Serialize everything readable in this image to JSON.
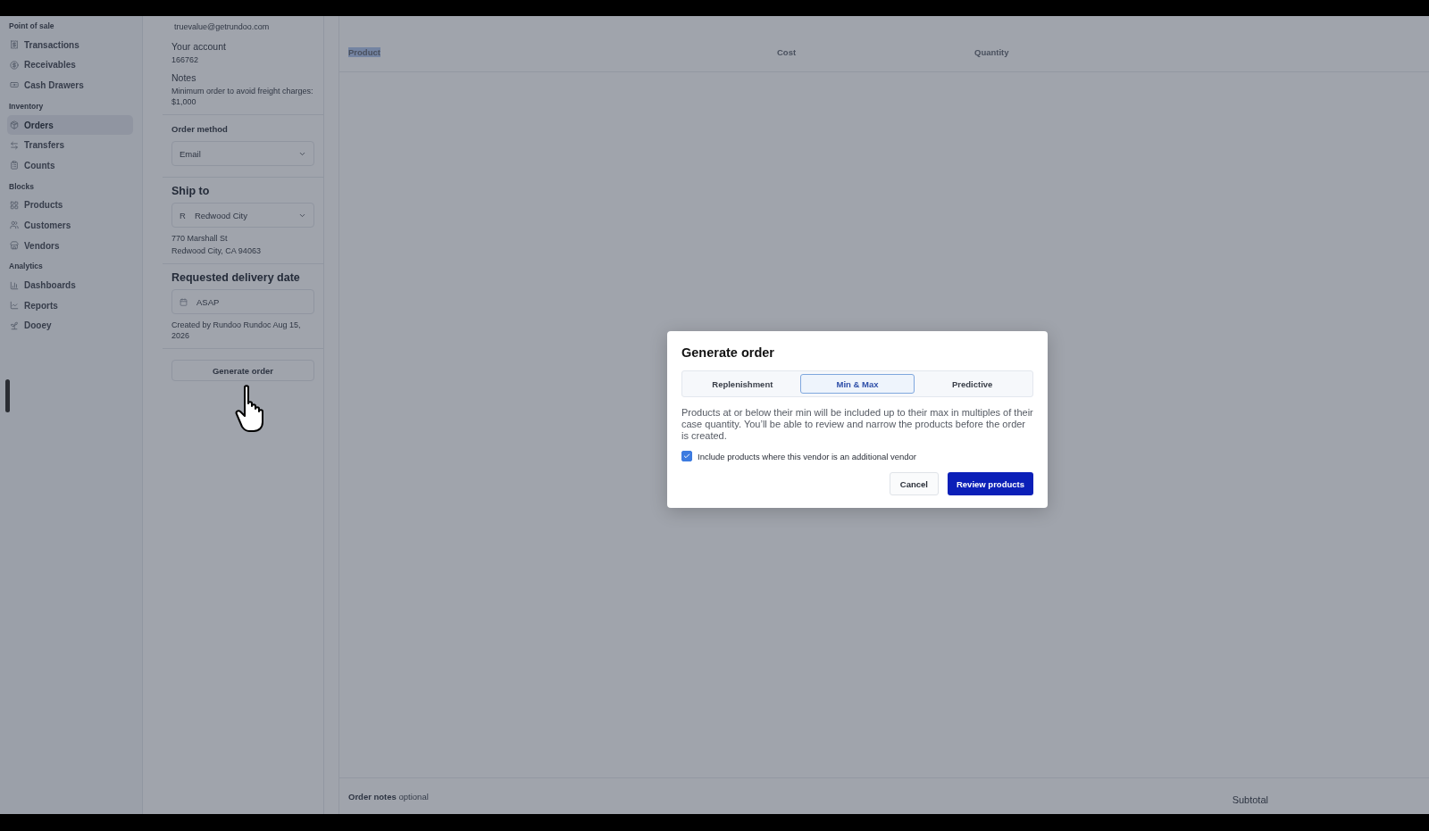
{
  "sidebar": {
    "sections": [
      {
        "label": "Point of sale",
        "items": [
          {
            "label": "Transactions",
            "selected": false
          },
          {
            "label": "Receivables",
            "selected": false
          },
          {
            "label": "Cash Drawers",
            "selected": false
          }
        ]
      },
      {
        "label": "Inventory",
        "items": [
          {
            "label": "Orders",
            "selected": true
          },
          {
            "label": "Transfers",
            "selected": false
          },
          {
            "label": "Counts",
            "selected": false
          }
        ]
      },
      {
        "label": "Blocks",
        "items": [
          {
            "label": "Products",
            "selected": false
          },
          {
            "label": "Customers",
            "selected": false
          },
          {
            "label": "Vendors",
            "selected": false
          }
        ]
      },
      {
        "label": "Analytics",
        "items": [
          {
            "label": "Dashboards",
            "selected": false
          },
          {
            "label": "Reports",
            "selected": false
          },
          {
            "label": "Dooey",
            "selected": false
          }
        ]
      }
    ]
  },
  "vendor_panel": {
    "email": "truevalue@getrundoo.com",
    "account_label": "Your account",
    "account_number": "166762",
    "notes_label": "Notes",
    "notes": "Minimum order to avoid freight charges: $1,000",
    "order_method": {
      "label": "Order method",
      "value": "Email"
    },
    "ship_to": {
      "title": "Ship to",
      "location_initial": "R",
      "location": "Redwood City",
      "address": [
        "770 Marshall St",
        "Redwood City, CA 94063"
      ]
    },
    "delivery": {
      "title": "Requested delivery date",
      "value": "ASAP",
      "created": "Created by Rundoo Rundoc Aug 15, 2026"
    },
    "generate_button": "Generate order"
  },
  "table": {
    "columns": [
      {
        "label": "Product",
        "highlighted": true
      },
      {
        "label": "Cost",
        "highlighted": false
      },
      {
        "label": "Quantity",
        "highlighted": false
      }
    ]
  },
  "footer": {
    "notes_label": "Order notes",
    "notes_hint": "optional",
    "subtotal_label": "Subtotal"
  },
  "dialog": {
    "title": "Generate order",
    "tabs": [
      {
        "label": "Replenishment",
        "selected": false
      },
      {
        "label": "Min & Max",
        "selected": true
      },
      {
        "label": "Predictive",
        "selected": false
      }
    ],
    "description": "Products at or below their min will be included up to their max in multiples of their case quantity. You’ll be able to review and narrow the products before the order is created.",
    "checkbox": {
      "label": "Include products where this vendor is an additional vendor",
      "checked": true
    },
    "buttons": {
      "cancel": "Cancel",
      "confirm": "Review products"
    }
  }
}
